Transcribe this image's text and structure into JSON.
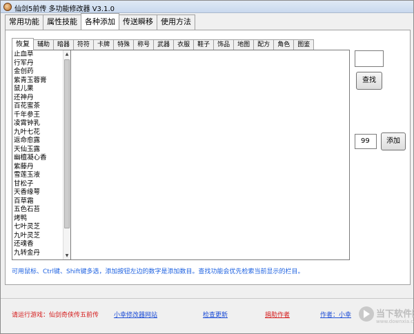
{
  "window": {
    "title": "仙剑5前传 多功能修改器 V3.1.0"
  },
  "main_tabs": [
    {
      "label": "常用功能",
      "active": false
    },
    {
      "label": "属性技能",
      "active": false
    },
    {
      "label": "各种添加",
      "active": true
    },
    {
      "label": "传送瞬移",
      "active": false
    },
    {
      "label": "使用方法",
      "active": false
    }
  ],
  "sub_tabs": [
    {
      "label": "恢复",
      "active": true
    },
    {
      "label": "辅助",
      "active": false
    },
    {
      "label": "暗器",
      "active": false
    },
    {
      "label": "符符",
      "active": false
    },
    {
      "label": "卡牌",
      "active": false
    },
    {
      "label": "特殊",
      "active": false
    },
    {
      "label": "称号",
      "active": false
    },
    {
      "label": "武器",
      "active": false
    },
    {
      "label": "衣服",
      "active": false
    },
    {
      "label": "鞋子",
      "active": false
    },
    {
      "label": "饰品",
      "active": false
    },
    {
      "label": "地图",
      "active": false
    },
    {
      "label": "配方",
      "active": false
    },
    {
      "label": "角色",
      "active": false
    },
    {
      "label": "图鉴",
      "active": false
    }
  ],
  "items": [
    "止血草",
    "行军丹",
    "金创药",
    "紫青玉蓉膏",
    "鼠儿果",
    "还神丹",
    "百花蜜茶",
    "千年参王",
    "凌霄钟乳",
    "九叶七花",
    "返命愈露",
    "天仙玉露",
    "幽檀凝心香",
    "紫藤丹",
    "雪莲玉液",
    "甘松子",
    "天香缘萼",
    "百草霜",
    "五色石苔",
    "烤鸭",
    "七叶灵芝",
    "九叶灵芝",
    "还魂香",
    "九转金丹"
  ],
  "search": {
    "value": "",
    "button_label": "查找"
  },
  "add": {
    "quantity": "99",
    "button_label": "添加"
  },
  "hint": "可用鼠标、Ctrl键、Shift键多选，添加按钮左边的数字是添加数目。查找功能会优先检索当前显示的栏目。",
  "footer": {
    "game": "请运行游戏：仙剑奇侠传五前传",
    "site_link": "小幸修改器网站",
    "update_link": "检查更新",
    "donate_link": "捐助作者",
    "author_link": "作者：小幸"
  },
  "watermark": {
    "text": "当下软件园",
    "url": "www.downxia.com"
  }
}
